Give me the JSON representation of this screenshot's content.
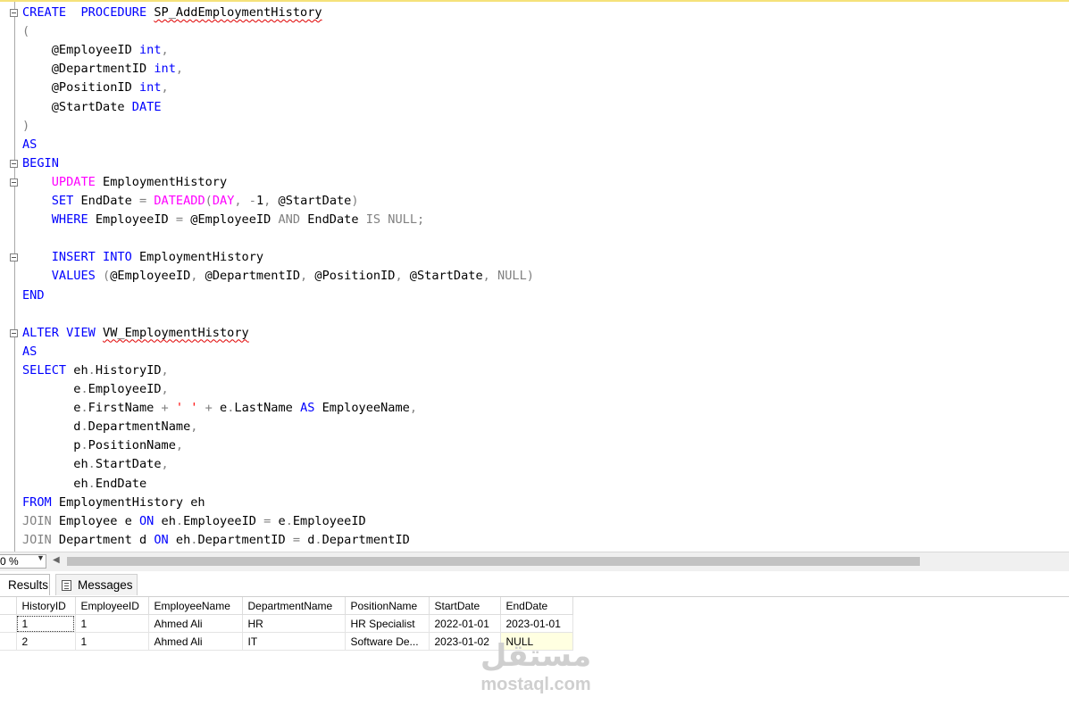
{
  "editor": {
    "lines": [
      [
        [
          "kw",
          "CREATE"
        ],
        [
          "",
          "  "
        ],
        [
          "kw",
          "PROCEDURE"
        ],
        [
          "",
          " "
        ],
        [
          "sq",
          "SP_AddEmploymentHistory"
        ]
      ],
      [
        [
          "gr",
          "("
        ]
      ],
      [
        [
          "",
          "    @EmployeeID "
        ],
        [
          "kw",
          "int"
        ],
        [
          "gr",
          ","
        ]
      ],
      [
        [
          "",
          "    @DepartmentID "
        ],
        [
          "kw",
          "int"
        ],
        [
          "gr",
          ","
        ]
      ],
      [
        [
          "",
          "    @PositionID "
        ],
        [
          "kw",
          "int"
        ],
        [
          "gr",
          ","
        ]
      ],
      [
        [
          "",
          "    @StartDate "
        ],
        [
          "kw",
          "DATE"
        ]
      ],
      [
        [
          "gr",
          ")"
        ]
      ],
      [
        [
          "kw",
          "AS"
        ]
      ],
      [
        [
          "kw",
          "BEGIN"
        ]
      ],
      [
        [
          "",
          "    "
        ],
        [
          "fn",
          "UPDATE"
        ],
        [
          "",
          " EmploymentHistory"
        ]
      ],
      [
        [
          "",
          "    "
        ],
        [
          "kw",
          "SET"
        ],
        [
          "",
          " EndDate "
        ],
        [
          "gr",
          "="
        ],
        [
          "",
          " "
        ],
        [
          "fn",
          "DATEADD"
        ],
        [
          "gr",
          "("
        ],
        [
          "fn",
          "DAY"
        ],
        [
          "gr",
          ","
        ],
        [
          "",
          " "
        ],
        [
          "gr",
          "-"
        ],
        [
          "",
          "1"
        ],
        [
          "gr",
          ","
        ],
        [
          "",
          " @StartDate"
        ],
        [
          "gr",
          ")"
        ]
      ],
      [
        [
          "",
          "    "
        ],
        [
          "kw",
          "WHERE"
        ],
        [
          "",
          " EmployeeID "
        ],
        [
          "gr",
          "="
        ],
        [
          "",
          " @EmployeeID "
        ],
        [
          "gr",
          "AND"
        ],
        [
          "",
          " EndDate "
        ],
        [
          "gr",
          "IS NULL"
        ],
        [
          "gr",
          ";"
        ]
      ],
      [],
      [
        [
          "",
          "    "
        ],
        [
          "kw",
          "INSERT"
        ],
        [
          "",
          " "
        ],
        [
          "kw",
          "INTO"
        ],
        [
          "",
          " EmploymentHistory"
        ]
      ],
      [
        [
          "",
          "    "
        ],
        [
          "kw",
          "VALUES"
        ],
        [
          "",
          " "
        ],
        [
          "gr",
          "("
        ],
        [
          "",
          "@EmployeeID"
        ],
        [
          "gr",
          ","
        ],
        [
          "",
          " @DepartmentID"
        ],
        [
          "gr",
          ","
        ],
        [
          "",
          " @PositionID"
        ],
        [
          "gr",
          ","
        ],
        [
          "",
          " @StartDate"
        ],
        [
          "gr",
          ","
        ],
        [
          "",
          " "
        ],
        [
          "gr",
          "NULL)"
        ]
      ],
      [
        [
          "kw",
          "END"
        ]
      ],
      [],
      [
        [
          "kw",
          "ALTER"
        ],
        [
          "",
          " "
        ],
        [
          "kw",
          "VIEW"
        ],
        [
          "",
          " "
        ],
        [
          "sq",
          "VW_EmploymentHistory"
        ]
      ],
      [
        [
          "kw",
          "AS"
        ]
      ],
      [
        [
          "kw",
          "SELECT"
        ],
        [
          "",
          " eh"
        ],
        [
          "gr",
          "."
        ],
        [
          "",
          "HistoryID"
        ],
        [
          "gr",
          ","
        ]
      ],
      [
        [
          "",
          "       e"
        ],
        [
          "gr",
          "."
        ],
        [
          "",
          "EmployeeID"
        ],
        [
          "gr",
          ","
        ]
      ],
      [
        [
          "",
          "       e"
        ],
        [
          "gr",
          "."
        ],
        [
          "",
          "FirstName "
        ],
        [
          "gr",
          "+"
        ],
        [
          "",
          " "
        ],
        [
          "str",
          "' '"
        ],
        [
          "",
          " "
        ],
        [
          "gr",
          "+"
        ],
        [
          "",
          " e"
        ],
        [
          "gr",
          "."
        ],
        [
          "",
          "LastName "
        ],
        [
          "kw",
          "AS"
        ],
        [
          "",
          " EmployeeName"
        ],
        [
          "gr",
          ","
        ]
      ],
      [
        [
          "",
          "       d"
        ],
        [
          "gr",
          "."
        ],
        [
          "",
          "DepartmentName"
        ],
        [
          "gr",
          ","
        ]
      ],
      [
        [
          "",
          "       p"
        ],
        [
          "gr",
          "."
        ],
        [
          "",
          "PositionName"
        ],
        [
          "gr",
          ","
        ]
      ],
      [
        [
          "",
          "       eh"
        ],
        [
          "gr",
          "."
        ],
        [
          "",
          "StartDate"
        ],
        [
          "gr",
          ","
        ]
      ],
      [
        [
          "",
          "       eh"
        ],
        [
          "gr",
          "."
        ],
        [
          "",
          "EndDate"
        ]
      ],
      [
        [
          "kw",
          "FROM"
        ],
        [
          "",
          " EmploymentHistory eh"
        ]
      ],
      [
        [
          "gr",
          "JOIN"
        ],
        [
          "",
          " Employee e "
        ],
        [
          "kw",
          "ON"
        ],
        [
          "",
          " eh"
        ],
        [
          "gr",
          "."
        ],
        [
          "",
          "EmployeeID "
        ],
        [
          "gr",
          "="
        ],
        [
          "",
          " e"
        ],
        [
          "gr",
          "."
        ],
        [
          "",
          "EmployeeID"
        ]
      ],
      [
        [
          "gr",
          "JOIN"
        ],
        [
          "",
          " Department d "
        ],
        [
          "kw",
          "ON"
        ],
        [
          "",
          " eh"
        ],
        [
          "gr",
          "."
        ],
        [
          "",
          "DepartmentID "
        ],
        [
          "gr",
          "="
        ],
        [
          "",
          " d"
        ],
        [
          "gr",
          "."
        ],
        [
          "",
          "DepartmentID"
        ]
      ]
    ]
  },
  "zoom": {
    "value": "0 %"
  },
  "tabs": {
    "results": "Results",
    "messages": "Messages"
  },
  "results": {
    "columns": [
      "HistoryID",
      "EmployeeID",
      "EmployeeName",
      "DepartmentName",
      "PositionName",
      "StartDate",
      "EndDate"
    ],
    "rows": [
      [
        "1",
        "1",
        "Ahmed Ali",
        "HR",
        "HR Specialist",
        "2022-01-01",
        "2023-01-01"
      ],
      [
        "2",
        "1",
        "Ahmed Ali",
        "IT",
        "Software De...",
        "2023-01-02",
        "NULL"
      ]
    ]
  },
  "watermark": {
    "arabic": "مستقل",
    "latin": "mostaql.com"
  }
}
